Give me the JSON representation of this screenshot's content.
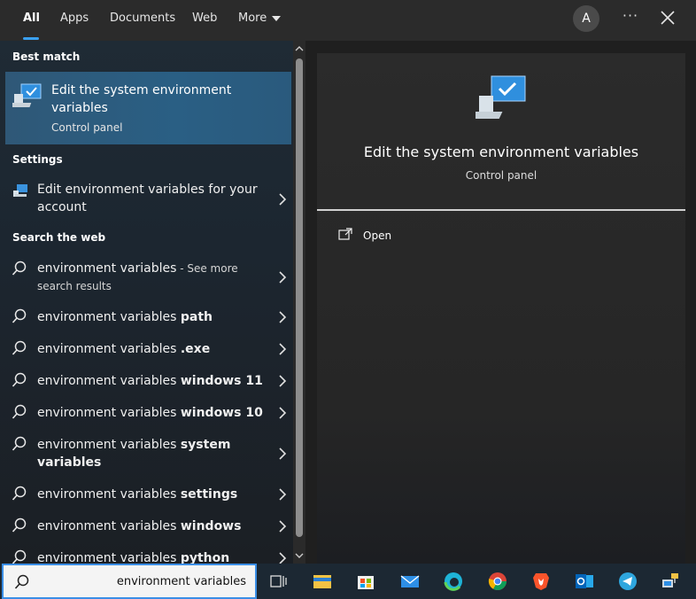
{
  "nav": {
    "tabs": [
      {
        "label": "All"
      },
      {
        "label": "Apps"
      },
      {
        "label": "Documents"
      },
      {
        "label": "Web"
      },
      {
        "label": "More"
      }
    ],
    "avatar_initial": "A",
    "dots": "···"
  },
  "sections": {
    "best_match": "Best match",
    "settings": "Settings",
    "search_web": "Search the web"
  },
  "best_match": {
    "title": "Edit the system environment variables",
    "subtitle": "Control panel"
  },
  "settings_item": {
    "title": "Edit environment variables for your account"
  },
  "web_results": [
    {
      "prefix": "environment variables",
      "suffix": "",
      "extra": " - See more search results"
    },
    {
      "prefix": "environment variables ",
      "suffix": "path",
      "extra": ""
    },
    {
      "prefix": "environment variables ",
      "suffix": ".exe",
      "extra": ""
    },
    {
      "prefix": "environment variables ",
      "suffix": "windows 11",
      "extra": ""
    },
    {
      "prefix": "environment variables ",
      "suffix": "windows 10",
      "extra": ""
    },
    {
      "prefix": "environment variables ",
      "suffix": "system variables",
      "extra": ""
    },
    {
      "prefix": "environment variables ",
      "suffix": "settings",
      "extra": ""
    },
    {
      "prefix": "environment variables ",
      "suffix": "windows",
      "extra": ""
    },
    {
      "prefix": "environment variables ",
      "suffix": "python",
      "extra": ""
    }
  ],
  "preview": {
    "title": "Edit the system environment variables",
    "subtitle": "Control panel",
    "open_label": "Open"
  },
  "taskbar": {
    "search_value": "environment variables",
    "icons": [
      "task-view-icon",
      "file-explorer-icon",
      "microsoft-store-icon",
      "mail-icon",
      "edge-icon",
      "chrome-icon",
      "brave-icon",
      "outlook-icon",
      "telegram-icon",
      "network-app-icon"
    ]
  },
  "colors": {
    "accent": "#3aa0f0",
    "best_match_bg": "#2a5f84",
    "panel_bg": "#2b2b2b"
  }
}
